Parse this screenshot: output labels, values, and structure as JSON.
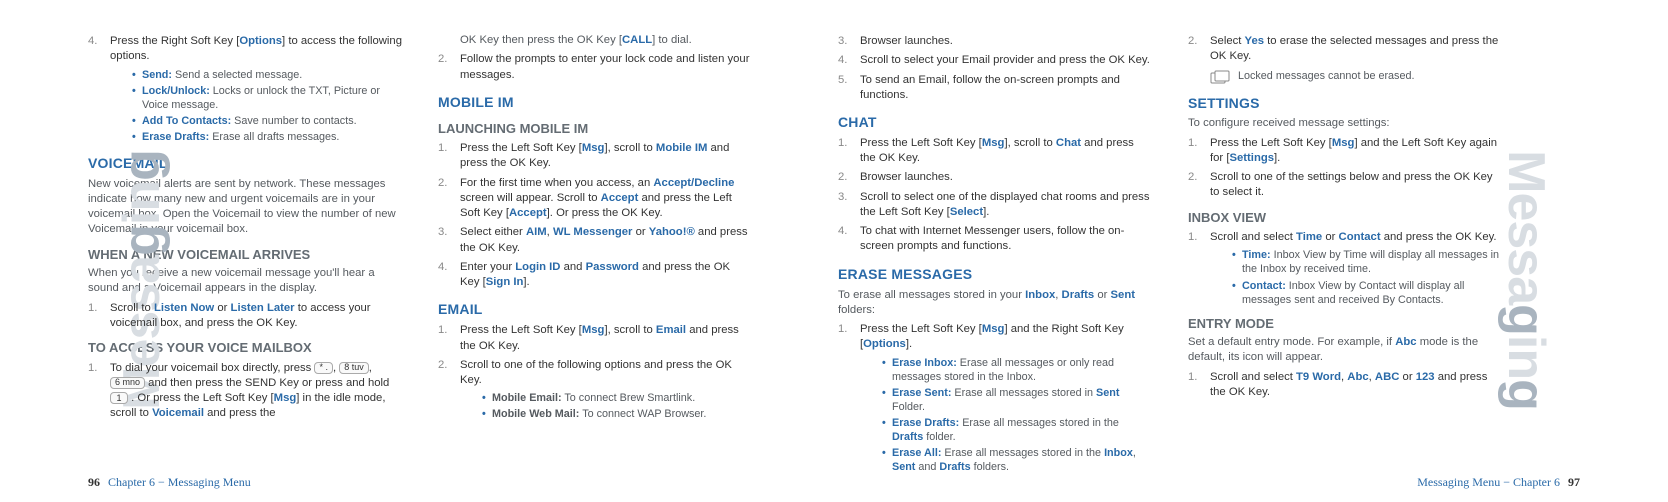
{
  "side_label_plain": "Messa",
  "side_label_accent": "g",
  "side_label_plain2": "in",
  "side_label_accent2": "g",
  "col1": {
    "step4": "Press the Right Soft Key [",
    "step4_key": "Options",
    "step4_tail": "] to access the following options.",
    "opts": {
      "send_b": "Send:",
      "send_t": " Send a selected message.",
      "lock_b": "Lock/Unlock:",
      "lock_t": " Locks or unlock the TXT, Picture or Voice message.",
      "add_b": "Add To Contacts:",
      "add_t": " Save number to contacts.",
      "erase_b": "Erase Drafts:",
      "erase_t": " Erase all drafts messages."
    },
    "voicemail_h": "VOICEMAIL",
    "voicemail_p": "New voicemail alerts are sent by network. These messages indicate how many new and urgent voicemails are in your voicemail box. Open the Voicemail to view the number of new Voicemail in your voicemail box.",
    "vm_arrives_h": "WHEN A NEW VOICEMAIL ARRIVES",
    "vm_arrives_p": "When you receive a new voicemail message you'll hear a sound and a Voicemail appears in the display.",
    "vm_li1_a": "Scroll to ",
    "vm_li1_b1": "Listen Now",
    "vm_li1_or": " or ",
    "vm_li1_b2": "Listen Later",
    "vm_li1_c": " to access your voicemail box, and press the OK Key.",
    "vm_access_h": "TO ACCESS YOUR VOICE MAILBOX",
    "vm_acc_a": "To dial your voicemail box directly, press ",
    "vm_acc_b": " and then press the SEND Key or press and hold ",
    "vm_acc_c": ". Or press the Left Soft Key [",
    "vm_acc_msg": "Msg",
    "vm_acc_d": "] in the idle mode, scroll to ",
    "vm_acc_vm": "Voicemail",
    "vm_acc_e": " and press the",
    "key_star": "* .",
    "key_8": "8 tuv",
    "key_6": "6 mno",
    "key_1": "1"
  },
  "col2": {
    "top_a": "OK Key then press the OK Key [",
    "top_key": "CALL",
    "top_b": "] to dial.",
    "li2": "Follow the prompts to enter your lock code and listen your messages.",
    "mobileim_h": "MOBILE IM",
    "launch_h": "LAUNCHING MOBILE IM",
    "mi1_a": "Press the Left Soft Key [",
    "mi1_msg": "Msg",
    "mi1_b": "], scroll to ",
    "mi1_tgt": "Mobile IM",
    "mi1_c": " and press the OK Key.",
    "mi2_a": "For the first time when you access, an ",
    "mi2_ad": "Accept/Decline",
    "mi2_b": " screen will appear. Scroll to ",
    "mi2_acc": "Accept",
    "mi2_c": " and press the Left Soft Key [",
    "mi2_acc2": "Accept",
    "mi2_d": "]. Or press the OK Key.",
    "mi3_a": "Select either ",
    "mi3_aim": "AIM",
    "mi3_sep1": ", ",
    "mi3_wl": "WL Messenger",
    "mi3_sep2": " or ",
    "mi3_y": "Yahoo!®",
    "mi3_c": " and press the OK Key.",
    "mi4_a": "Enter your ",
    "mi4_login": "Login ID",
    "mi4_and": " and ",
    "mi4_pw": "Password",
    "mi4_b": " and press the OK Key [",
    "mi4_sign": "Sign In",
    "mi4_c": "].",
    "email_h": "EMAIL",
    "em1_a": "Press the Left Soft Key [",
    "em1_msg": "Msg",
    "em1_b": "], scroll to ",
    "em1_tgt": "Email",
    "em1_c": " and press the OK Key.",
    "em2": "Scroll to one of the following options and press the OK Key.",
    "em_opt1_b": "Mobile Email:",
    "em_opt1_t": " To connect Brew Smartlink.",
    "em_opt2_b": "Mobile Web Mail:",
    "em_opt2_t": " To connect WAP Browser."
  },
  "col3": {
    "li3": "Browser launches.",
    "li4": "Scroll to select your Email provider and press the OK Key.",
    "li5": "To send an Email, follow the on-screen prompts and functions.",
    "chat_h": "CHAT",
    "ch1_a": "Press the Left Soft Key [",
    "ch1_msg": "Msg",
    "ch1_b": "], scroll to ",
    "ch1_tgt": "Chat",
    "ch1_c": " and press the OK Key.",
    "ch2": "Browser launches.",
    "ch3_a": "Scroll to select one of the displayed chat rooms and press the Left Soft Key [",
    "ch3_sel": "Select",
    "ch3_b": "].",
    "ch4": "To chat with Internet Messenger users, follow the on-screen prompts and functions.",
    "erase_h": "ERASE MESSAGES",
    "erase_p_a": "To erase all messages stored in your ",
    "erase_p_inbox": "Inbox",
    "erase_p_sep1": ", ",
    "erase_p_drafts": "Drafts",
    "erase_p_sep2": " or ",
    "erase_p_sent": "Sent",
    "erase_p_b": " folders:",
    "er1_a": "Press the Left Soft Key [",
    "er1_msg": "Msg",
    "er1_b": "] and the Right Soft Key [",
    "er1_opt": "Options",
    "er1_c": "].",
    "eo1_b": "Erase Inbox:",
    "eo1_t": " Erase all messages or only read messages stored in the Inbox.",
    "eo2_b": "Erase Sent:",
    "eo2_ta": " Erase all messages stored in ",
    "eo2_sent": "Sent",
    "eo2_tb": " Folder.",
    "eo3_b": "Erase Drafts:",
    "eo3_ta": " Erase all messages stored in the ",
    "eo3_dr": "Drafts",
    "eo3_tb": " folder.",
    "eo4_b": "Erase All:",
    "eo4_ta": " Erase all messages stored in the ",
    "eo4_in": "Inbox",
    "eo4_s1": ", ",
    "eo4_se": "Sent",
    "eo4_s2": " and ",
    "eo4_dr": "Drafts",
    "eo4_tb": " folders."
  },
  "col4": {
    "li2_a": "Select ",
    "li2_yes": "Yes",
    "li2_b": " to erase the selected messages and press the OK Key.",
    "note": "Locked messages cannot be erased.",
    "settings_h": "SETTINGS",
    "settings_p": "To configure received message settings:",
    "s1_a": "Press the Left Soft Key [",
    "s1_msg": "Msg",
    "s1_b": "] and the Left Soft Key again for [",
    "s1_set": "Settings",
    "s1_c": "].",
    "s2": "Scroll to one of the settings below and press the OK Key to select it.",
    "inbox_h": "INBOX VIEW",
    "iv1_a": "Scroll and select ",
    "iv1_time": "Time",
    "iv1_or": " or ",
    "iv1_contact": "Contact",
    "iv1_b": " and press the OK Key.",
    "ivopt1_b": "Time:",
    "ivopt1_t": " Inbox View by Time will display all messages in the Inbox by received time.",
    "ivopt2_b": "Contact:",
    "ivopt2_t": " Inbox View by Contact will display all messages sent and received By Contacts.",
    "entry_h": "ENTRY MODE",
    "entry_p_a": "Set a default entry mode. For example, if ",
    "entry_abc": "Abc",
    "entry_p_b": " mode is the default, its icon will appear.",
    "em1_a": "Scroll and select ",
    "em1_t9": "T9 Word",
    "em1_s1": ", ",
    "em1_abc": "Abc",
    "em1_s2": ", ",
    "em1_ABC": "ABC",
    "em1_s3": " or ",
    "em1_123": "123",
    "em1_b": " and press the OK Key."
  },
  "footer": {
    "left_pg": "96",
    "left_txt": "Chapter 6 − Messaging Menu",
    "right_txt": "Messaging Menu − Chapter 6",
    "right_pg": "97"
  }
}
